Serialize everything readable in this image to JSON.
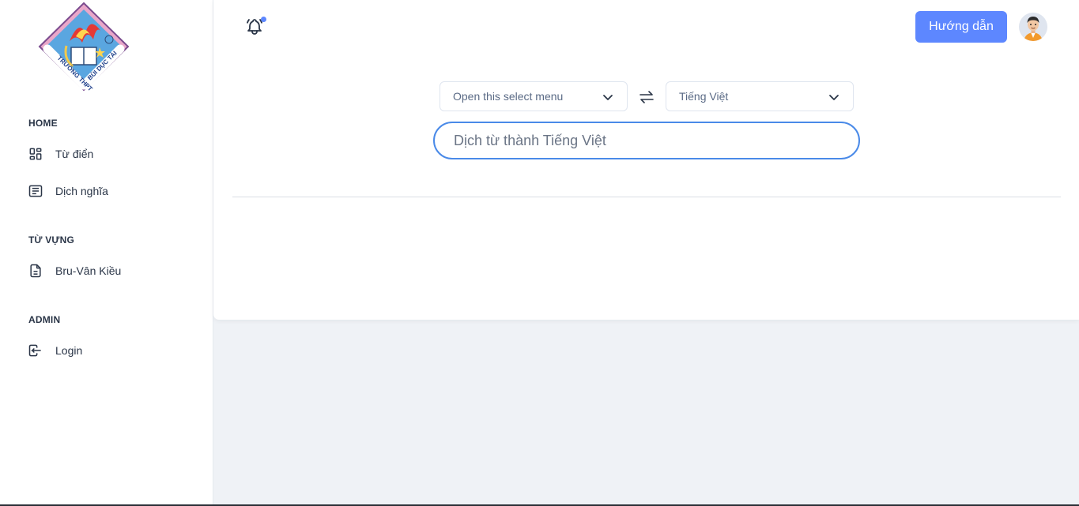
{
  "logo": {
    "top_text": "TRƯỜNG THPT",
    "bottom_text": "BÙI DỤC TÀI"
  },
  "sidebar": {
    "sections": [
      {
        "title": "HOME",
        "items": [
          {
            "label": "Từ điển",
            "icon": "dashboard-icon"
          },
          {
            "label": "Dịch nghĩa",
            "icon": "article-icon"
          }
        ]
      },
      {
        "title": "TỪ VỰNG",
        "items": [
          {
            "label": "Bru-Vân Kiều",
            "icon": "file-text-icon"
          }
        ]
      },
      {
        "title": "ADMIN",
        "items": [
          {
            "label": "Login",
            "icon": "login-icon"
          }
        ]
      }
    ]
  },
  "header": {
    "bell_icon": "bell-ringing-icon",
    "guide_label": "Hướng dẫn",
    "avatar_icon": "user-avatar"
  },
  "translator": {
    "source_select": "Open this select menu",
    "target_select": "Tiếng Việt",
    "swap_icon": "arrows-exchange-icon",
    "input_placeholder": "Dịch từ thành Tiếng Việt",
    "input_value": ""
  },
  "colors": {
    "accent": "#5d87ff",
    "input_border": "#4a8ae8",
    "page_bg": "#eff2f6"
  }
}
